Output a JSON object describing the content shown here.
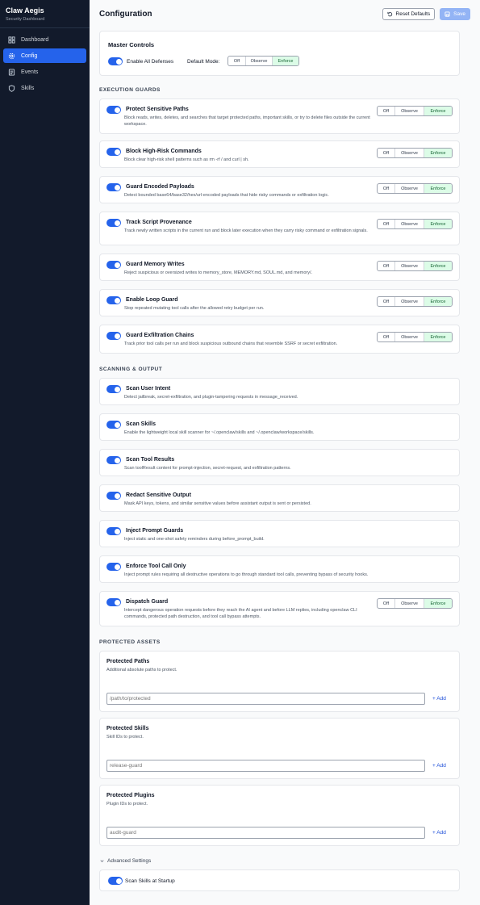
{
  "app": {
    "title": "Claw Aegis",
    "subtitle": "Security Dashboard"
  },
  "nav": [
    {
      "label": "Dashboard",
      "icon": "grid-icon"
    },
    {
      "label": "Config",
      "icon": "gear-icon"
    },
    {
      "label": "Events",
      "icon": "list-icon"
    },
    {
      "label": "Skills",
      "icon": "shield-icon"
    }
  ],
  "header": {
    "title": "Configuration",
    "reset_label": "Reset Defaults",
    "save_label": "Save"
  },
  "master": {
    "title": "Master Controls",
    "enable_label": "Enable All Defenses",
    "mode_label": "Default Mode:",
    "modes": [
      "Off",
      "Observe",
      "Enforce"
    ],
    "selected": "Enforce"
  },
  "sections": {
    "guards": "EXECUTION GUARDS",
    "scanning": "SCANNING & OUTPUT",
    "assets": "PROTECTED ASSETS"
  },
  "modes": [
    "Off",
    "Observe",
    "Enforce"
  ],
  "guards": [
    {
      "title": "Protect Sensitive Paths",
      "desc": "Block reads, writes, deletes, and searches that target protected paths, important skills, or try to delete files outside the current workspace.",
      "mode": "Enforce",
      "enabled": true
    },
    {
      "title": "Block High-Risk Commands",
      "desc": "Block clear high-risk shell patterns such as rm -rf / and curl | sh.",
      "mode": "Enforce",
      "enabled": true
    },
    {
      "title": "Guard Encoded Payloads",
      "desc": "Detect bounded base64/base32/hex/url-encoded payloads that hide risky commands or exfiltration logic.",
      "mode": "Enforce",
      "enabled": true
    },
    {
      "title": "Track Script Provenance",
      "desc": "Track newly written scripts in the current run and block later execution when they carry risky command or exfiltration signals.",
      "mode": "Enforce",
      "enabled": true
    },
    {
      "title": "Guard Memory Writes",
      "desc": "Reject suspicious or oversized writes to memory_store, MEMORY.md, SOUL.md, and memory/.",
      "mode": "Enforce",
      "enabled": true
    },
    {
      "title": "Enable Loop Guard",
      "desc": "Stop repeated mutating tool calls after the allowed retry budget per run.",
      "mode": "Enforce",
      "enabled": true
    },
    {
      "title": "Guard Exfiltration Chains",
      "desc": "Track prior tool calls per run and block suspicious outbound chains that resemble SSRF or secret exfiltration.",
      "mode": "Enforce",
      "enabled": true
    }
  ],
  "scanning": [
    {
      "title": "Scan User Intent",
      "desc": "Detect jailbreak, secret-exfiltration, and plugin-tampering requests in message_received.",
      "enabled": true
    },
    {
      "title": "Scan Skills",
      "desc": "Enable the lightweight local skill scanner for ~/.openclaw/skills and ~/.openclaw/workspace/skills.",
      "enabled": true
    },
    {
      "title": "Scan Tool Results",
      "desc": "Scan toolResult content for prompt-injection, secret-request, and exfiltration patterns.",
      "enabled": true
    },
    {
      "title": "Redact Sensitive Output",
      "desc": "Mask API keys, tokens, and similar sensitive values before assistant output is sent or persisted.",
      "enabled": true
    },
    {
      "title": "Inject Prompt Guards",
      "desc": "Inject static and one-shot safety reminders during before_prompt_build.",
      "enabled": true
    },
    {
      "title": "Enforce Tool Call Only",
      "desc": "Inject prompt rules requiring all destructive operations to go through standard tool calls, preventing bypass of security hooks.",
      "enabled": true
    },
    {
      "title": "Dispatch Guard",
      "desc": "Intercept dangerous operation requests before they reach the AI agent and before LLM replies, including openclaw CLI commands, protected path destruction, and tool call bypass attempts.",
      "mode": "Enforce",
      "enabled": true
    }
  ],
  "assets": [
    {
      "title": "Protected Paths",
      "desc": "Additional absolute paths to protect.",
      "placeholder": "/path/to/protected",
      "add": "+ Add"
    },
    {
      "title": "Protected Skills",
      "desc": "Skill IDs to protect.",
      "placeholder": "release-guard",
      "add": "+ Add"
    },
    {
      "title": "Protected Plugins",
      "desc": "Plugin IDs to protect.",
      "placeholder": "audit-guard",
      "add": "+ Add"
    }
  ],
  "advanced": {
    "label": "Advanced Settings",
    "startup_label": "Scan Skills at Startup",
    "startup_enabled": true
  }
}
